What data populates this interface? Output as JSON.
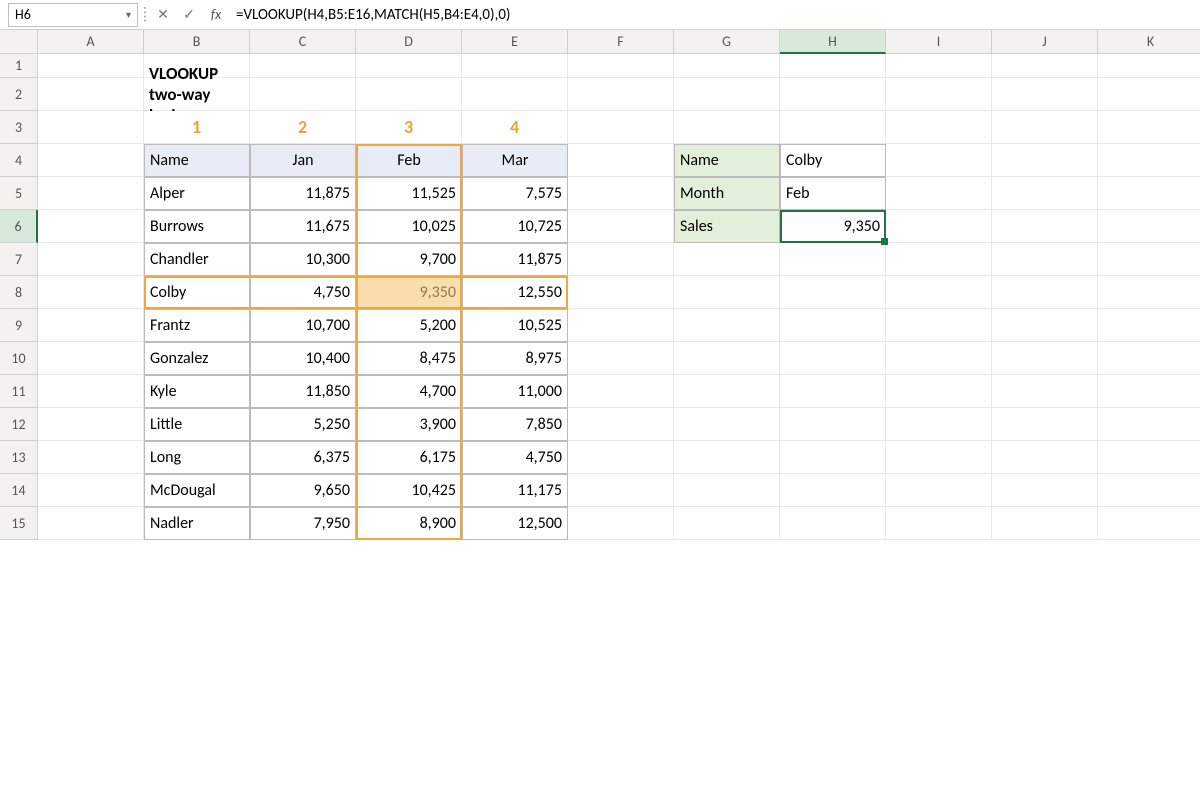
{
  "nameBox": "H6",
  "formula": "=VLOOKUP(H4,B5:E16,MATCH(H5,B4:E4,0),0)",
  "columns": [
    "A",
    "B",
    "C",
    "D",
    "E",
    "F",
    "G",
    "H",
    "I",
    "J",
    "K"
  ],
  "rows": [
    "1",
    "2",
    "3",
    "4",
    "5",
    "6",
    "7",
    "8",
    "9",
    "10",
    "11",
    "12",
    "13",
    "14",
    "15"
  ],
  "activeCol": "H",
  "activeRow": "6",
  "title": "VLOOKUP two-way lookup",
  "colNums": [
    "1",
    "2",
    "3",
    "4"
  ],
  "headers": [
    "Name",
    "Jan",
    "Feb",
    "Mar"
  ],
  "data": [
    {
      "name": "Alper",
      "jan": "11,875",
      "feb": "11,525",
      "mar": "7,575"
    },
    {
      "name": "Burrows",
      "jan": "11,675",
      "feb": "10,025",
      "mar": "10,725"
    },
    {
      "name": "Chandler",
      "jan": "10,300",
      "feb": "9,700",
      "mar": "11,875"
    },
    {
      "name": "Colby",
      "jan": "4,750",
      "feb": "9,350",
      "mar": "12,550"
    },
    {
      "name": "Frantz",
      "jan": "10,700",
      "feb": "5,200",
      "mar": "10,525"
    },
    {
      "name": "Gonzalez",
      "jan": "10,400",
      "feb": "8,475",
      "mar": "8,975"
    },
    {
      "name": "Kyle",
      "jan": "11,850",
      "feb": "4,700",
      "mar": "11,000"
    },
    {
      "name": "Little",
      "jan": "5,250",
      "feb": "3,900",
      "mar": "7,850"
    },
    {
      "name": "Long",
      "jan": "6,375",
      "feb": "6,175",
      "mar": "4,750"
    },
    {
      "name": "McDougal",
      "jan": "9,650",
      "feb": "10,425",
      "mar": "11,175"
    },
    {
      "name": "Nadler",
      "jan": "7,950",
      "feb": "8,900",
      "mar": "12,500"
    }
  ],
  "lookup": {
    "nameLabel": "Name",
    "nameVal": "Colby",
    "monthLabel": "Month",
    "monthVal": "Feb",
    "salesLabel": "Sales",
    "salesVal": "9,350"
  },
  "chart_data": {
    "type": "table",
    "title": "VLOOKUP two-way lookup",
    "columns": [
      "Name",
      "Jan",
      "Feb",
      "Mar"
    ],
    "rows": [
      [
        "Alper",
        11875,
        11525,
        7575
      ],
      [
        "Burrows",
        11675,
        10025,
        10725
      ],
      [
        "Chandler",
        10300,
        9700,
        11875
      ],
      [
        "Colby",
        4750,
        9350,
        12550
      ],
      [
        "Frantz",
        10700,
        5200,
        10525
      ],
      [
        "Gonzalez",
        10400,
        8475,
        8975
      ],
      [
        "Kyle",
        11850,
        4700,
        11000
      ],
      [
        "Little",
        5250,
        3900,
        7850
      ],
      [
        "Long",
        6375,
        6175,
        4750
      ],
      [
        "McDougal",
        9650,
        10425,
        11175
      ],
      [
        "Nadler",
        7950,
        8900,
        12500
      ]
    ],
    "lookup": {
      "Name": "Colby",
      "Month": "Feb",
      "Sales": 9350
    }
  }
}
